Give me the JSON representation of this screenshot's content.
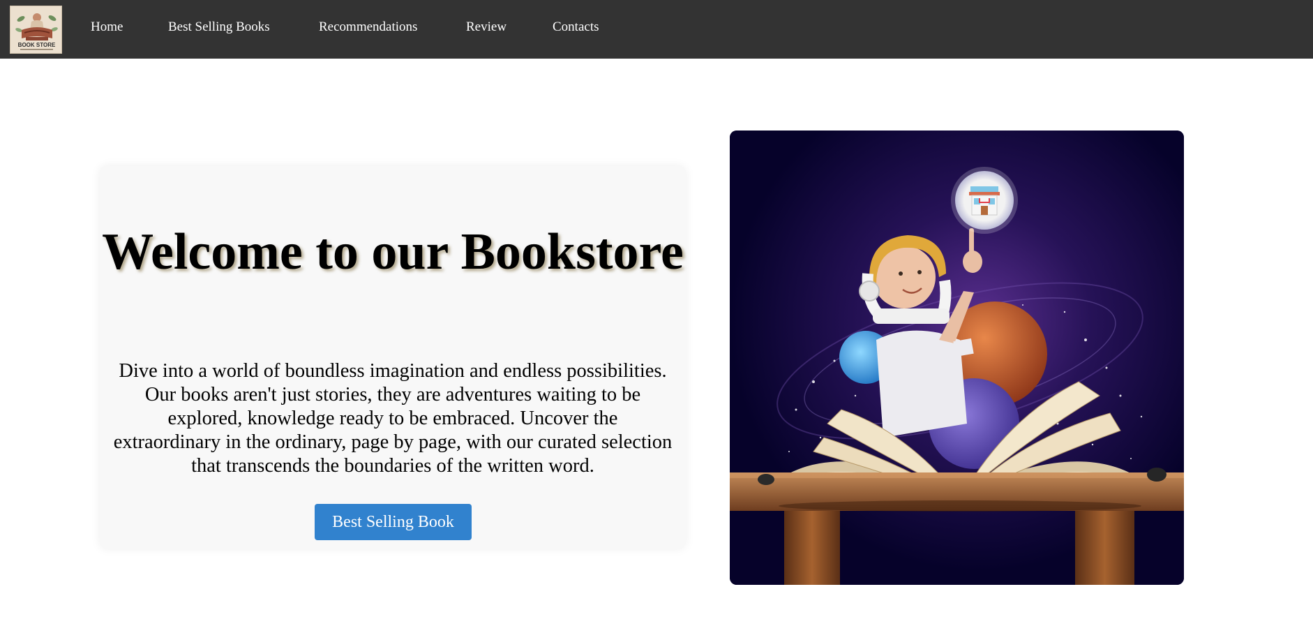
{
  "nav": {
    "logo_text": "BOOK STORE",
    "links": [
      {
        "label": "Home"
      },
      {
        "label": "Best Selling Books"
      },
      {
        "label": "Recommendations"
      },
      {
        "label": "Review"
      },
      {
        "label": "Contacts"
      }
    ]
  },
  "hero": {
    "title": "Welcome to our Bookstore",
    "text": "Dive into a world of boundless imagination and endless possibilities. Our books aren't just stories, they are adventures waiting to be explored, knowledge ready to be embraced. Uncover the extraordinary in the ordinary, page by page, with our curated selection that transcends the boundaries of the written word.",
    "button_label": "Best Selling Book"
  },
  "colors": {
    "navbar_bg": "#333333",
    "card_bg": "#f8f8f8",
    "button_bg": "#3182ce"
  }
}
